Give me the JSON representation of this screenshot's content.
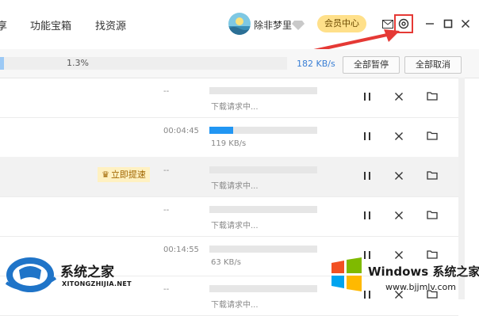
{
  "header": {
    "nav": [
      {
        "label": "享"
      },
      {
        "label": "功能宝箱"
      },
      {
        "label": "找资源"
      }
    ],
    "username": "除非梦里",
    "vip_label": "会员中心"
  },
  "summary": {
    "progress_text": "1.3%",
    "progress": 0.013,
    "speed": "182 KB/s",
    "pause_all": "全部暂停",
    "cancel_all": "全部取消"
  },
  "rows": [
    {
      "time": "--",
      "status": "下载请求中...",
      "progress": 0,
      "alt": false
    },
    {
      "time": "00:04:45",
      "status": "119 KB/s",
      "progress": 0.22,
      "alt": false
    },
    {
      "time": "--",
      "status": "下载请求中...",
      "progress": 0,
      "alt": true,
      "boost": "立即提速"
    },
    {
      "time": "--",
      "status": "下载请求中...",
      "progress": 0,
      "alt": false
    },
    {
      "time": "00:14:55",
      "status": "63 KB/s",
      "progress": 0,
      "alt": false
    },
    {
      "time": "--",
      "status": "下载请求中...",
      "progress": 0,
      "alt": false
    }
  ],
  "watermarks": {
    "left_title": "系统之家",
    "left_url": "XITONGZHIJIA.NET",
    "right_title": "Windows 系统之家",
    "right_url": "www.bjjmlv.com"
  },
  "colors": {
    "accent": "#2196f3",
    "vip": "#ffe08a",
    "highlight_box": "#e53935"
  }
}
